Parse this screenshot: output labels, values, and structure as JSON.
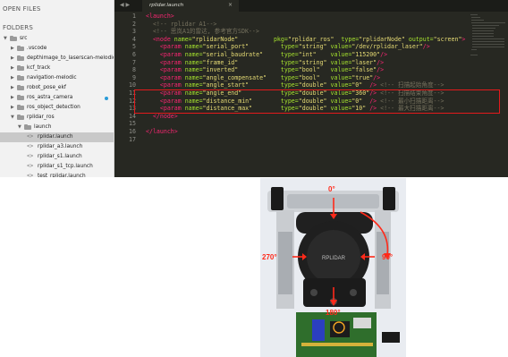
{
  "sidebar": {
    "open_files_header": "OPEN FILES",
    "folders_header": "FOLDERS",
    "tree": [
      {
        "label": "src",
        "depth": 0,
        "kind": "folder",
        "expanded": true
      },
      {
        "label": ".vscode",
        "depth": 1,
        "kind": "folder",
        "expanded": false
      },
      {
        "label": "depthimage_to_laserscan-melodic-de",
        "depth": 1,
        "kind": "folder",
        "expanded": false
      },
      {
        "label": "kcf_track",
        "depth": 1,
        "kind": "folder",
        "expanded": false
      },
      {
        "label": "navigation-melodic",
        "depth": 1,
        "kind": "folder",
        "expanded": false
      },
      {
        "label": "robot_pose_ekf",
        "depth": 1,
        "kind": "folder",
        "expanded": false
      },
      {
        "label": "ros_astra_camera",
        "depth": 1,
        "kind": "folder",
        "expanded": false,
        "badge": true
      },
      {
        "label": "ros_object_detection",
        "depth": 1,
        "kind": "folder",
        "expanded": false
      },
      {
        "label": "rplidar_ros",
        "depth": 1,
        "kind": "folder",
        "expanded": true
      },
      {
        "label": "launch",
        "depth": 2,
        "kind": "folder",
        "expanded": true
      },
      {
        "label": "rplidar.launch",
        "depth": 3,
        "kind": "file",
        "selected": true
      },
      {
        "label": "rplidar_a3.launch",
        "depth": 3,
        "kind": "file"
      },
      {
        "label": "rplidar_s1.launch",
        "depth": 3,
        "kind": "file"
      },
      {
        "label": "rplidar_s1_tcp.launch",
        "depth": 3,
        "kind": "file"
      },
      {
        "label": "test_rplidar.launch",
        "depth": 3,
        "kind": "file"
      },
      {
        "label": "test_rplidar_a3.launch",
        "depth": 3,
        "kind": "file"
      }
    ]
  },
  "editor": {
    "nav_arrows": "◀ ▶",
    "tab_label": "rplidar.launch",
    "tab_close": "×",
    "line_numbers": [
      "1",
      "2",
      "3",
      "4",
      "5",
      "6",
      "7",
      "8",
      "9",
      "10",
      "11",
      "12",
      "13",
      "14",
      "15",
      "16",
      "17"
    ],
    "lines": [
      [
        [
          "t",
          "<launch>"
        ]
      ],
      [
        [
          "c",
          "  <!-- rplidar A1-->"
        ]
      ],
      [
        [
          "c",
          "  <!-- 思岚A1的雷达, 参考官方SDK-->"
        ]
      ],
      [
        [
          "p",
          "  "
        ],
        [
          "t",
          "<node "
        ],
        [
          "a",
          "name="
        ],
        [
          "s",
          "\"rplidarNode\""
        ],
        [
          "p",
          "          "
        ],
        [
          "a",
          "pkg="
        ],
        [
          "s",
          "\"rplidar_ros\""
        ],
        [
          "p",
          "  "
        ],
        [
          "a",
          "type="
        ],
        [
          "s",
          "\"rplidarNode\""
        ],
        [
          "p",
          " "
        ],
        [
          "a",
          "output="
        ],
        [
          "s",
          "\"screen\""
        ],
        [
          "t",
          ">"
        ]
      ],
      [
        [
          "p",
          "    "
        ],
        [
          "t",
          "<param "
        ],
        [
          "a",
          "name="
        ],
        [
          "s",
          "\"serial_port\""
        ],
        [
          "p",
          "         "
        ],
        [
          "a",
          "type="
        ],
        [
          "s",
          "\"string\""
        ],
        [
          "p",
          " "
        ],
        [
          "a",
          "value="
        ],
        [
          "s",
          "\"/dev/rplidar_laser\""
        ],
        [
          "t",
          "/>"
        ]
      ],
      [
        [
          "p",
          "    "
        ],
        [
          "t",
          "<param "
        ],
        [
          "a",
          "name="
        ],
        [
          "s",
          "\"serial_baudrate\""
        ],
        [
          "p",
          "     "
        ],
        [
          "a",
          "type="
        ],
        [
          "s",
          "\"int\""
        ],
        [
          "p",
          "    "
        ],
        [
          "a",
          "value="
        ],
        [
          "s",
          "\"115200\""
        ],
        [
          "t",
          "/>"
        ]
      ],
      [
        [
          "p",
          "    "
        ],
        [
          "t",
          "<param "
        ],
        [
          "a",
          "name="
        ],
        [
          "s",
          "\"frame_id\""
        ],
        [
          "p",
          "            "
        ],
        [
          "a",
          "type="
        ],
        [
          "s",
          "\"string\""
        ],
        [
          "p",
          " "
        ],
        [
          "a",
          "value="
        ],
        [
          "s",
          "\"laser\""
        ],
        [
          "t",
          "/>"
        ]
      ],
      [
        [
          "p",
          "    "
        ],
        [
          "t",
          "<param "
        ],
        [
          "a",
          "name="
        ],
        [
          "s",
          "\"inverted\""
        ],
        [
          "p",
          "            "
        ],
        [
          "a",
          "type="
        ],
        [
          "s",
          "\"bool\""
        ],
        [
          "p",
          "   "
        ],
        [
          "a",
          "value="
        ],
        [
          "s",
          "\"false\""
        ],
        [
          "t",
          "/>"
        ]
      ],
      [
        [
          "p",
          "    "
        ],
        [
          "t",
          "<param "
        ],
        [
          "a",
          "name="
        ],
        [
          "s",
          "\"angle_compensate\""
        ],
        [
          "p",
          "    "
        ],
        [
          "a",
          "type="
        ],
        [
          "s",
          "\"bool\""
        ],
        [
          "p",
          "   "
        ],
        [
          "a",
          "value="
        ],
        [
          "s",
          "\"true\""
        ],
        [
          "t",
          "/>"
        ]
      ],
      [
        [
          "p",
          "    "
        ],
        [
          "t",
          "<param "
        ],
        [
          "a",
          "name="
        ],
        [
          "s",
          "\"angle_start\""
        ],
        [
          "p",
          "         "
        ],
        [
          "a",
          "type="
        ],
        [
          "s",
          "\"double\""
        ],
        [
          "p",
          " "
        ],
        [
          "a",
          "value="
        ],
        [
          "s",
          "\"0\""
        ],
        [
          "p",
          "  "
        ],
        [
          "t",
          "/> "
        ],
        [
          "c",
          "<!-- 扫描起始角度-->"
        ]
      ],
      [
        [
          "p",
          "    "
        ],
        [
          "t",
          "<param "
        ],
        [
          "a",
          "name="
        ],
        [
          "s",
          "\"angle_end\""
        ],
        [
          "p",
          "           "
        ],
        [
          "a",
          "type="
        ],
        [
          "s",
          "\"double\""
        ],
        [
          "p",
          " "
        ],
        [
          "a",
          "value="
        ],
        [
          "s",
          "\"360\""
        ],
        [
          "t",
          "/> "
        ],
        [
          "c",
          "<!-- 扫描结束角度-->"
        ]
      ],
      [
        [
          "p",
          "    "
        ],
        [
          "t",
          "<param "
        ],
        [
          "a",
          "name="
        ],
        [
          "s",
          "\"distance_min\""
        ],
        [
          "p",
          "        "
        ],
        [
          "a",
          "type="
        ],
        [
          "s",
          "\"double\""
        ],
        [
          "p",
          " "
        ],
        [
          "a",
          "value="
        ],
        [
          "s",
          "\"0\""
        ],
        [
          "p",
          "  "
        ],
        [
          "t",
          "/> "
        ],
        [
          "c",
          "<!-- 最小扫描距离-->"
        ]
      ],
      [
        [
          "p",
          "    "
        ],
        [
          "t",
          "<param "
        ],
        [
          "a",
          "name="
        ],
        [
          "s",
          "\"distance_max\""
        ],
        [
          "p",
          "        "
        ],
        [
          "a",
          "type="
        ],
        [
          "s",
          "\"double\""
        ],
        [
          "p",
          " "
        ],
        [
          "a",
          "value="
        ],
        [
          "s",
          "\"10\""
        ],
        [
          "p",
          " "
        ],
        [
          "t",
          "/> "
        ],
        [
          "c",
          "<!-- 最大扫描距离-->"
        ]
      ],
      [
        [
          "p",
          "  "
        ],
        [
          "t",
          "</node>"
        ]
      ],
      [
        [
          "p",
          ""
        ]
      ],
      [
        [
          "t",
          "</launch>"
        ]
      ],
      [
        [
          "p",
          ""
        ]
      ]
    ],
    "highlight_color": "#e31a1c"
  },
  "photo": {
    "device_logo": "RPLIDAR",
    "angles": {
      "top": "0°",
      "left": "270°",
      "right": "90°",
      "bottom": "180°"
    },
    "annotation_color": "#ff2a1a"
  }
}
